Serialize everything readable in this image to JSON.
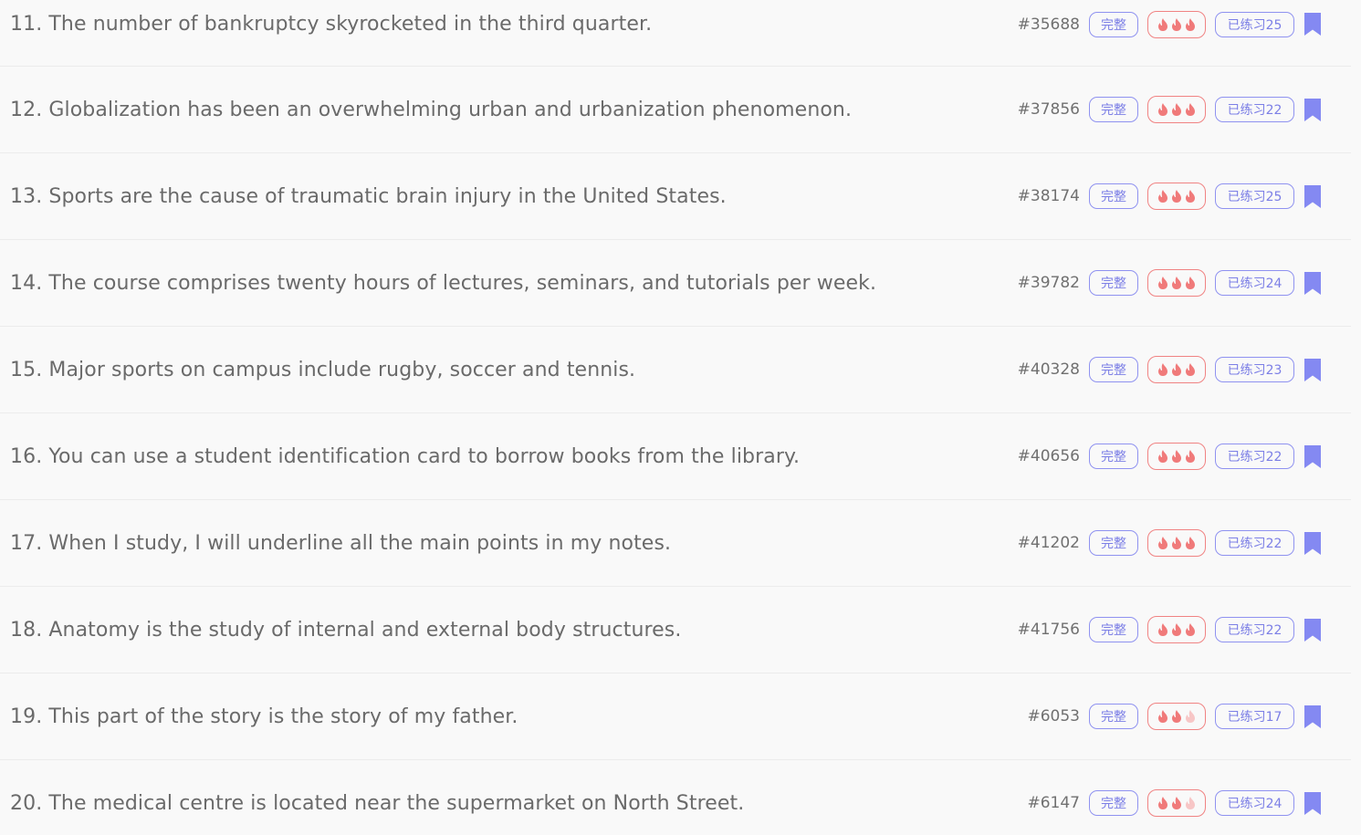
{
  "colors": {
    "accent": "#7c7fe6",
    "bookmark": "#8489f2",
    "flame_active": "#f07a7a",
    "flame_inactive": "#f7c6c6",
    "hot_border": "#f08383"
  },
  "rows": [
    {
      "sentence": "11. The number of bankruptcy skyrocketed in the third quarter.",
      "id": "#35688",
      "complete": "完整",
      "practiced": "已练习25",
      "flames": 3
    },
    {
      "sentence": "12. Globalization has been an overwhelming urban and urbanization phenomenon.",
      "id": "#37856",
      "complete": "完整",
      "practiced": "已练习22",
      "flames": 3
    },
    {
      "sentence": "13. Sports are the cause of traumatic brain injury in the United States.",
      "id": "#38174",
      "complete": "完整",
      "practiced": "已练习25",
      "flames": 3
    },
    {
      "sentence": "14. The course comprises twenty hours of lectures, seminars, and tutorials per week.",
      "id": "#39782",
      "complete": "完整",
      "practiced": "已练习24",
      "flames": 3
    },
    {
      "sentence": "15. Major sports on campus include rugby, soccer and tennis.",
      "id": "#40328",
      "complete": "完整",
      "practiced": "已练习23",
      "flames": 3
    },
    {
      "sentence": "16. You can use a student identification card to borrow books from the library.",
      "id": "#40656",
      "complete": "完整",
      "practiced": "已练习22",
      "flames": 3
    },
    {
      "sentence": "17. When I study, I will underline all the main points in my notes.",
      "id": "#41202",
      "complete": "完整",
      "practiced": "已练习22",
      "flames": 3
    },
    {
      "sentence": "18. Anatomy is the study of internal and external body structures.",
      "id": "#41756",
      "complete": "完整",
      "practiced": "已练习22",
      "flames": 3
    },
    {
      "sentence": "19. This part of the story is the story of my father.",
      "id": "#6053",
      "complete": "完整",
      "practiced": "已练习17",
      "flames": 2
    },
    {
      "sentence": "20. The medical centre is located near the supermarket on North Street.",
      "id": "#6147",
      "complete": "完整",
      "practiced": "已练习24",
      "flames": 2
    }
  ]
}
